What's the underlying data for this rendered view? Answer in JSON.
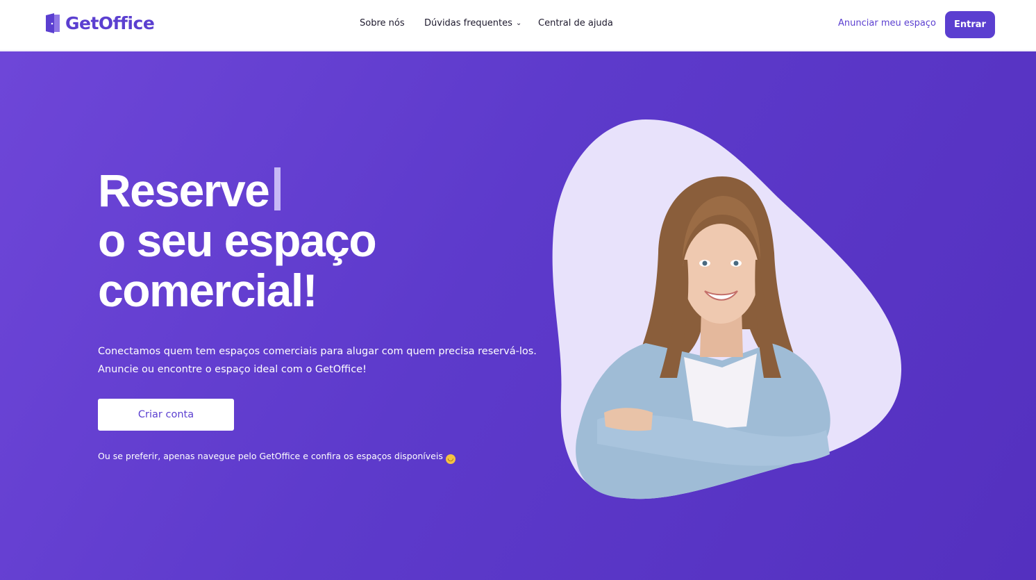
{
  "header": {
    "brand": "GetOffice",
    "nav": {
      "about": "Sobre nós",
      "faq": "Dúvidas frequentes",
      "help": "Central de ajuda"
    },
    "announce_link": "Anunciar meu espaço",
    "login_button": "Entrar"
  },
  "hero": {
    "headline_line1": "Reserve",
    "headline_line2": "o seu espaço",
    "headline_line3": "comercial!",
    "description_line1": "Conectamos quem tem espaços comerciais para alugar com quem precisa reservá-los.",
    "description_line2": "Anuncie ou encontre o espaço ideal com o GetOffice!",
    "cta_button": "Criar conta",
    "browse_note": "Ou se preferir, apenas navegue pelo GetOffice e confira os espaços disponíveis"
  },
  "icons": {
    "logo": "door-icon",
    "faq_dropdown": "chevron-down-icon",
    "emoji": "smile-emoji-icon"
  },
  "colors": {
    "brand": "#5b3fd0",
    "hero_background": "#5d3acb",
    "blob": "#e8e2fb",
    "text_dark": "#1e1a2e"
  }
}
